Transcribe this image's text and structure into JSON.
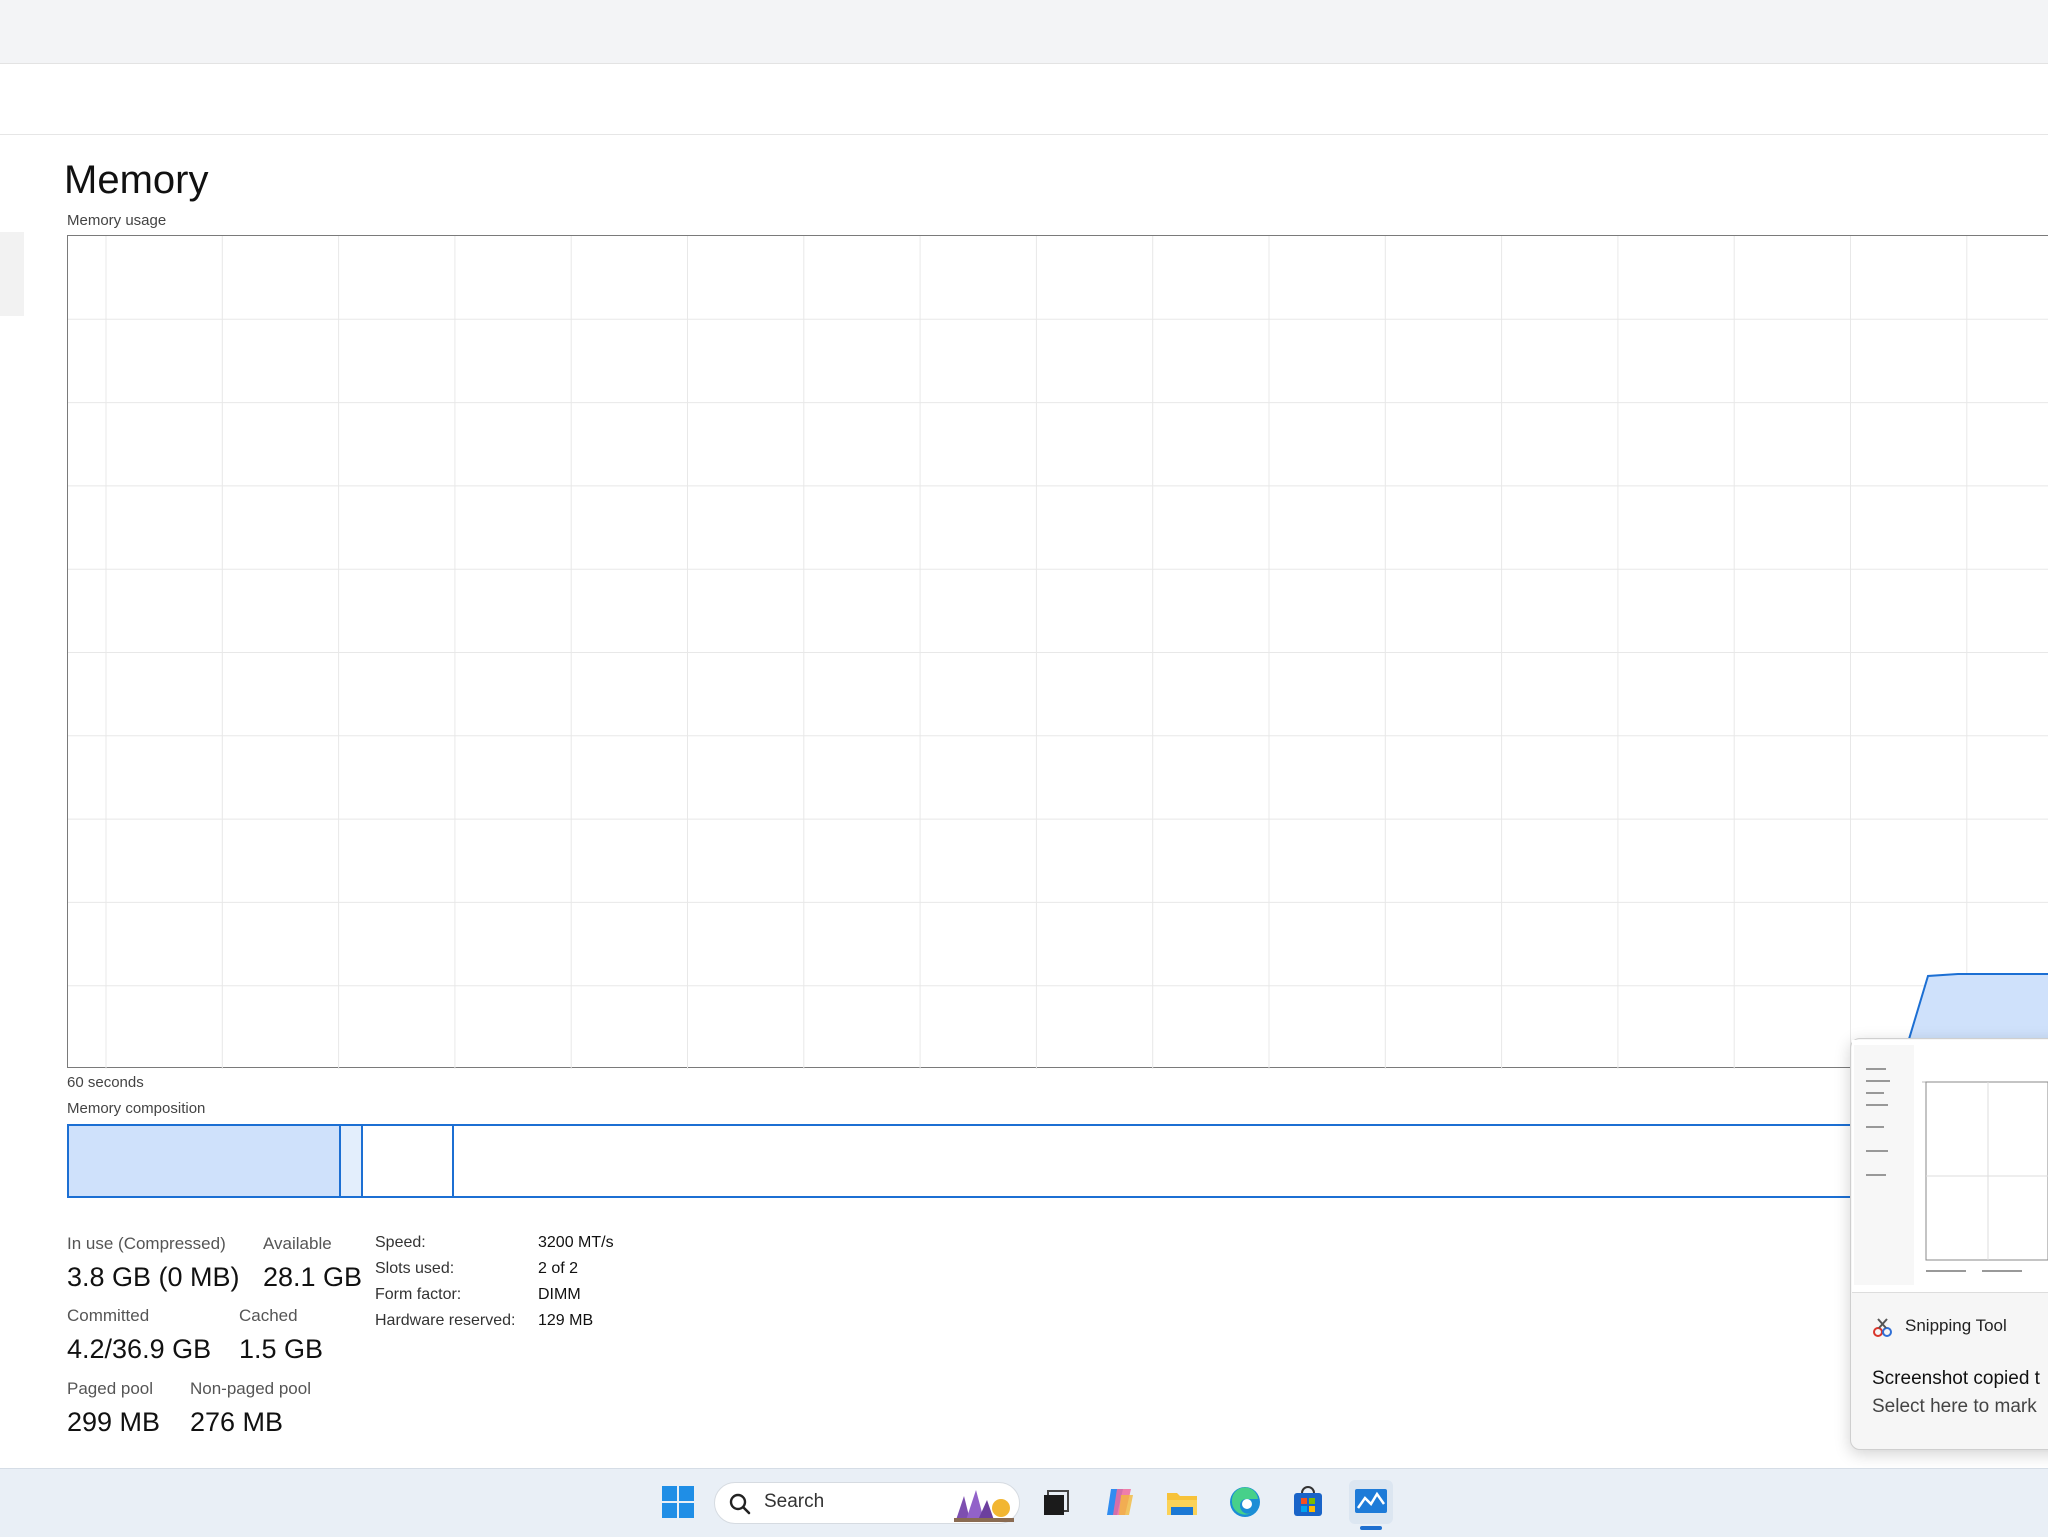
{
  "page": {
    "title": "Memory",
    "graph_label": "Memory usage",
    "time_label": "60 seconds",
    "composition_label": "Memory composition"
  },
  "stats": {
    "in_use_label": "In use (Compressed)",
    "in_use_value": "3.8 GB (0 MB)",
    "available_label": "Available",
    "available_value": "28.1 GB",
    "committed_label": "Committed",
    "committed_value": "4.2/36.9 GB",
    "cached_label": "Cached",
    "cached_value": "1.5 GB",
    "paged_label": "Paged pool",
    "paged_value": "299 MB",
    "nonpaged_label": "Non-paged pool",
    "nonpaged_value": "276 MB"
  },
  "specs": {
    "speed_label": "Speed:",
    "speed_value": "3200 MT/s",
    "slots_label": "Slots used:",
    "slots_value": "2 of 2",
    "form_label": "Form factor:",
    "form_value": "DIMM",
    "hw_label": "Hardware reserved:",
    "hw_value": "129 MB"
  },
  "taskbar": {
    "search_placeholder": "Search",
    "icons": [
      "windows-start-icon",
      "search-icon",
      "task-view-icon",
      "copilot-icon",
      "file-explorer-icon",
      "edge-icon",
      "store-icon",
      "task-manager-icon"
    ]
  },
  "toast": {
    "app_name": "Snipping Tool",
    "line1": "Screenshot copied t",
    "line2": "Select here to mark"
  },
  "colors": {
    "accent": "#1c6fd3",
    "graph_fill": "#cfe1fb",
    "grid": "#e8e8e8"
  }
}
